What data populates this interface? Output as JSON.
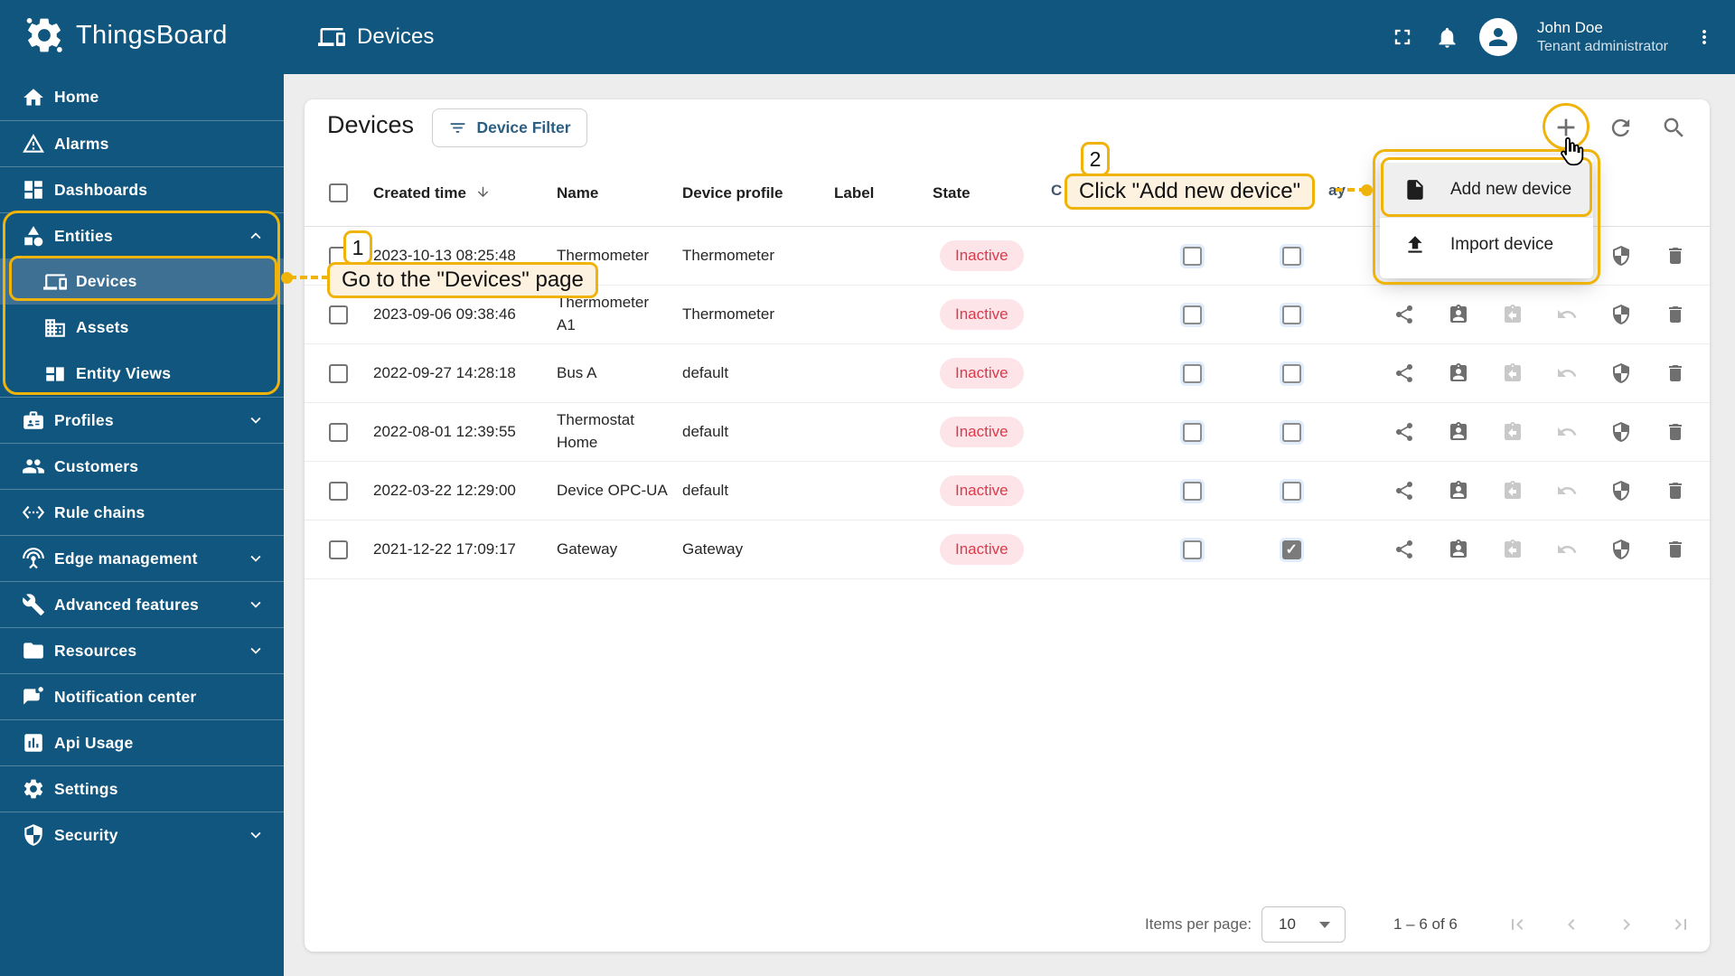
{
  "colors": {
    "primary_blue": "#10567E",
    "active_item_blue": "#3E7093",
    "accent_yellow": "#F0B30A",
    "callout_bg": "#FDF2DF",
    "inactive_text": "#DB3A4B",
    "inactive_bg": "#FCE4E8"
  },
  "header": {
    "logo_text": "ThingsBoard",
    "breadcrumb": "Devices",
    "user": {
      "name": "John Doe",
      "role": "Tenant administrator"
    },
    "icon_names": [
      "fullscreen-icon",
      "notifications-icon",
      "avatar-icon",
      "more-vert-icon"
    ]
  },
  "sidebar": {
    "items": [
      {
        "label": "Home",
        "icon": "home-icon"
      },
      {
        "label": "Alarms",
        "icon": "warning-icon"
      },
      {
        "label": "Dashboards",
        "icon": "dashboard-icon"
      },
      {
        "label": "Entities",
        "icon": "category-icon",
        "chevron": "up"
      },
      {
        "label": "Devices",
        "icon": "devices-icon",
        "indent": true,
        "active": true
      },
      {
        "label": "Assets",
        "icon": "building-icon",
        "indent": true
      },
      {
        "label": "Entity Views",
        "icon": "quilt-icon",
        "indent": true
      },
      {
        "label": "Profiles",
        "icon": "badge-icon",
        "chevron": "down"
      },
      {
        "label": "Customers",
        "icon": "people-icon"
      },
      {
        "label": "Rule chains",
        "icon": "ethernet-icon"
      },
      {
        "label": "Edge management",
        "icon": "antenna-icon",
        "chevron": "down"
      },
      {
        "label": "Advanced features",
        "icon": "tools-icon",
        "chevron": "down"
      },
      {
        "label": "Resources",
        "icon": "folder-icon",
        "chevron": "down"
      },
      {
        "label": "Notification center",
        "icon": "notification-icon"
      },
      {
        "label": "Api Usage",
        "icon": "chart-icon"
      },
      {
        "label": "Settings",
        "icon": "gear-icon"
      },
      {
        "label": "Security",
        "icon": "shield-icon",
        "chevron": "down"
      }
    ]
  },
  "page": {
    "title": "Devices",
    "filter_button_label": "Device Filter",
    "toolbar_icon_names": [
      "add-icon",
      "refresh-icon",
      "search-icon"
    ],
    "table": {
      "columns": {
        "created": "Created time",
        "name": "Name",
        "profile": "Device profile",
        "label": "Label",
        "state": "State",
        "customer_fragment": "C",
        "gateway_fragment": "ay"
      },
      "action_icon_names": [
        "share-icon",
        "assign-customer-icon",
        "credentials-copy-icon",
        "unassign-icon",
        "security-icon",
        "delete-icon"
      ],
      "rows": [
        {
          "created": "2023-10-13 08:25:48",
          "name": "Thermometer",
          "profile": "Thermometer",
          "label": "",
          "state": "Inactive",
          "public": false,
          "gateway": false
        },
        {
          "created": "2023-09-06 09:38:46",
          "name": "Thermometer A1",
          "profile": "Thermometer",
          "label": "",
          "state": "Inactive",
          "public": false,
          "gateway": false
        },
        {
          "created": "2022-09-27 14:28:18",
          "name": "Bus A",
          "profile": "default",
          "label": "",
          "state": "Inactive",
          "public": false,
          "gateway": false
        },
        {
          "created": "2022-08-01 12:39:55",
          "name": "Thermostat Home",
          "profile": "default",
          "label": "",
          "state": "Inactive",
          "public": false,
          "gateway": false
        },
        {
          "created": "2022-03-22 12:29:00",
          "name": "Device OPC-UA",
          "profile": "default",
          "label": "",
          "state": "Inactive",
          "public": false,
          "gateway": false
        },
        {
          "created": "2021-12-22 17:09:17",
          "name": "Gateway",
          "profile": "Gateway",
          "label": "",
          "state": "Inactive",
          "public": false,
          "gateway": true
        }
      ]
    },
    "pagination": {
      "items_per_page_label": "Items per page:",
      "page_size": "10",
      "range": "1 – 6 of 6"
    }
  },
  "context_menu": {
    "items": [
      {
        "label": "Add new device",
        "icon": "file-icon"
      },
      {
        "label": "Import device",
        "icon": "upload-icon"
      }
    ]
  },
  "annotations": {
    "step1": {
      "badge": "1",
      "text": "Go to the \"Devices\" page"
    },
    "step2": {
      "badge": "2",
      "text": "Click \"Add new device\""
    }
  }
}
